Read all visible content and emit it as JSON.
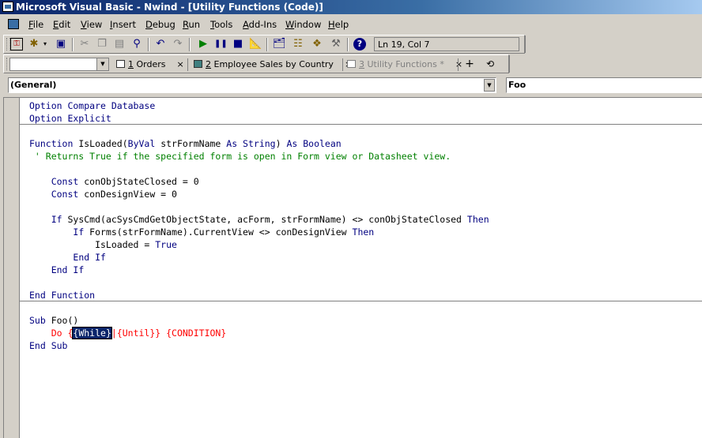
{
  "window": {
    "title": "Microsoft Visual Basic - Nwind - [Utility Functions (Code)]"
  },
  "menu": {
    "items": [
      {
        "key": "F",
        "rest": "ile"
      },
      {
        "key": "E",
        "rest": "dit"
      },
      {
        "key": "V",
        "rest": "iew"
      },
      {
        "key": "I",
        "rest": "nsert"
      },
      {
        "key": "D",
        "rest": "ebug"
      },
      {
        "key": "R",
        "rest": "un"
      },
      {
        "key": "T",
        "rest": "ools"
      },
      {
        "key": "A",
        "rest": "dd-Ins"
      },
      {
        "key": "W",
        "rest": "indow"
      },
      {
        "key": "H",
        "rest": "elp"
      }
    ]
  },
  "toolbar": {
    "position_text": "Ln 19, Col 7",
    "icons": [
      "view-access-icon",
      "insert-object-icon",
      "save-icon",
      "cut-icon",
      "copy-icon",
      "paste-icon",
      "find-icon",
      "undo-icon",
      "redo-icon",
      "run-icon",
      "break-icon",
      "reset-icon",
      "design-mode-icon",
      "project-explorer-icon",
      "properties-icon",
      "object-browser-icon",
      "toolbox-icon",
      "help-icon"
    ]
  },
  "tabs": {
    "items": [
      {
        "prefix": "1",
        "label": " Orders",
        "active": true
      },
      {
        "prefix": "2",
        "label": " Employee Sales by Country",
        "active": true
      },
      {
        "prefix": "3",
        "label": " Utility Functions *",
        "active": false
      }
    ],
    "add": "+",
    "close": "×"
  },
  "procedure_bar": {
    "object": "(General)",
    "procedure": "Foo"
  },
  "code": {
    "lines": [
      [
        [
          "kw",
          "Option Compare Database"
        ]
      ],
      [
        [
          "kw",
          "Option Explicit"
        ]
      ],
      [],
      [
        [
          "kw",
          "Function"
        ],
        [
          "tx",
          " IsLoaded("
        ],
        [
          "kw",
          "ByVal"
        ],
        [
          "tx",
          " strFormName "
        ],
        [
          "kw",
          "As String"
        ],
        [
          "tx",
          ") "
        ],
        [
          "kw",
          "As Boolean"
        ]
      ],
      [
        [
          "cm",
          " ' Returns True if the specified form is open in Form view or Datasheet view."
        ]
      ],
      [],
      [
        [
          "tx",
          "    "
        ],
        [
          "kw",
          "Const"
        ],
        [
          "tx",
          " conObjStateClosed = 0"
        ]
      ],
      [
        [
          "tx",
          "    "
        ],
        [
          "kw",
          "Const"
        ],
        [
          "tx",
          " conDesignView = 0"
        ]
      ],
      [],
      [
        [
          "tx",
          "    "
        ],
        [
          "kw",
          "If"
        ],
        [
          "tx",
          " SysCmd(acSysCmdGetObjectState, acForm, strFormName) <> conObjStateClosed "
        ],
        [
          "kw",
          "Then"
        ]
      ],
      [
        [
          "tx",
          "        "
        ],
        [
          "kw",
          "If"
        ],
        [
          "tx",
          " Forms(strFormName).CurrentView <> conDesignView "
        ],
        [
          "kw",
          "Then"
        ]
      ],
      [
        [
          "tx",
          "            IsLoaded = "
        ],
        [
          "kw",
          "True"
        ]
      ],
      [
        [
          "tx",
          "        "
        ],
        [
          "kw",
          "End If"
        ]
      ],
      [
        [
          "tx",
          "    "
        ],
        [
          "kw",
          "End If"
        ]
      ],
      [],
      [
        [
          "kw",
          "End Function"
        ]
      ],
      [],
      [
        [
          "kw",
          "Sub"
        ],
        [
          "tx",
          " Foo()"
        ]
      ],
      [
        [
          "tx",
          "    "
        ],
        [
          "err",
          "Do {"
        ],
        [
          "sel",
          "{While}"
        ],
        [
          "err",
          "|{Until}} {CONDITION}"
        ]
      ],
      [
        [
          "kw",
          "End Sub"
        ]
      ]
    ]
  }
}
